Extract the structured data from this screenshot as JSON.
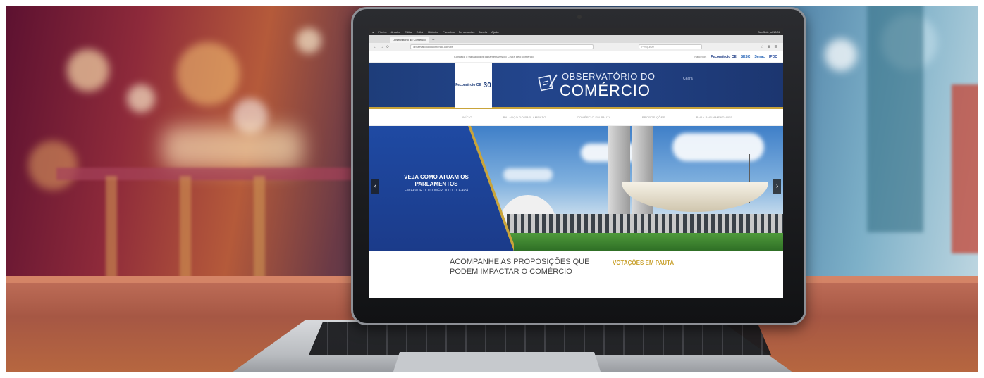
{
  "browser": {
    "menubar": [
      "Firefox",
      "Arquivo",
      "Editar",
      "Exibir",
      "Histórico",
      "Favoritos",
      "Ferramentas",
      "Janela",
      "Ajuda"
    ],
    "menubar_right": "Sex 5 de jul 18:08",
    "tab_title": "Observatório do Comércio",
    "tab_new": "+",
    "url": "observatoriodocomercio.com.br",
    "search_placeholder": "Pesquisar",
    "nav_back": "←",
    "nav_forward": "→",
    "nav_reload": "⟳"
  },
  "site": {
    "top_note": "Conheça o trabalho dos parlamentares do Ceará pelo comércio",
    "partners_label": "Parceiros",
    "partners": [
      "Fecomércio CE",
      "SESC",
      "Senac",
      "IPDC"
    ],
    "logo_small": "Fecomércio CE",
    "logo_number": "30",
    "title_line1": "OBSERVATÓRIO DO",
    "title_line2": "COMÉRCIO",
    "state": "Ceará",
    "nav": [
      "Início",
      "Balanço do Parlamento",
      "Comércio em Pauta",
      "Proposições",
      "Para Parlamentares"
    ],
    "slide": {
      "headline": "VEJA COMO ATUAM OS PARLAMENTOS",
      "subline": "EM FAVOR DO COMÉRCIO DO CEARÁ",
      "prev": "‹",
      "next": "›"
    },
    "section_heading": "ACOMPANHE AS PROPOSIÇÕES QUE PODEM IMPACTAR O COMÉRCIO",
    "section_votacoes": "VOTAÇÕES EM PAUTA"
  },
  "colors": {
    "brand_blue": "#1e3d7a",
    "gold_accent": "#c9a43a"
  }
}
